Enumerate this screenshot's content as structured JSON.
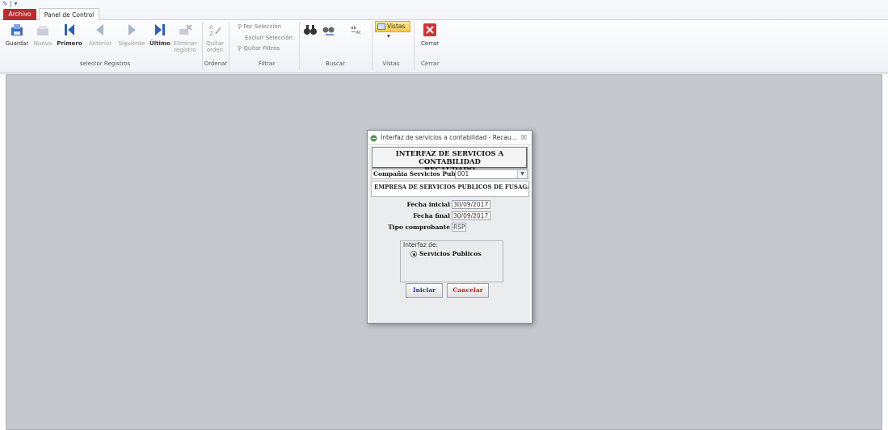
{
  "window": {
    "quick_access": "✎ | ▾"
  },
  "tabs": {
    "archivo": "Archivo",
    "panel": "Panel de Control"
  },
  "ribbon": {
    "buttons": {
      "guardar": "Guardar",
      "nuevo": "Nuevo",
      "primero": "Primero",
      "anterior": "Anterior",
      "siguiente": "Siguiente",
      "ultimo": "Último",
      "eliminar_1": "Eliminar",
      "eliminar_2": "registro",
      "quitar_1": "Quitar",
      "quitar_2": "orden",
      "vistas": "Vistas",
      "cerrar": "Cerrar"
    },
    "filtrar": {
      "por_seleccion": "Por Selección",
      "excluir_seleccion": "Excluir Selección",
      "quitar_filtros": "Quitar Filtros"
    },
    "groups": {
      "selector": "selector Registros",
      "ordenar": "Ordenar",
      "filtrar": "Filtrar",
      "buscar": "Buscar",
      "vistas": "Vistas",
      "cerrar": "Cerrar"
    }
  },
  "dialog": {
    "title": "Interfaz de servicios a contabilidad - Recau...",
    "close_glyph": "☒",
    "header_line1": "INTERFAZ DE SERVICIOS A CONTABILIDAD",
    "header_line2": "RECAUDADO",
    "compania_label": "Compañia Servicios Publicos",
    "compania_value": "001",
    "empresa_nombre": "EMPRESA DE SERVICIOS PUBLICOS DE FUSAGASUGA",
    "fecha_inicial_label": "Fecha inicial",
    "fecha_inicial_value": "30/09/2017",
    "fecha_final_label": "Fecha final",
    "fecha_final_value": "30/09/2017",
    "tipo_comprobante_label": "Tipo comprobante",
    "tipo_comprobante_value": "RSP",
    "interfaz_group_title": "Interfaz de:",
    "interfaz_option": "Servicios Publicos",
    "iniciar": "Iniciar",
    "cancelar": "Cancelar"
  }
}
